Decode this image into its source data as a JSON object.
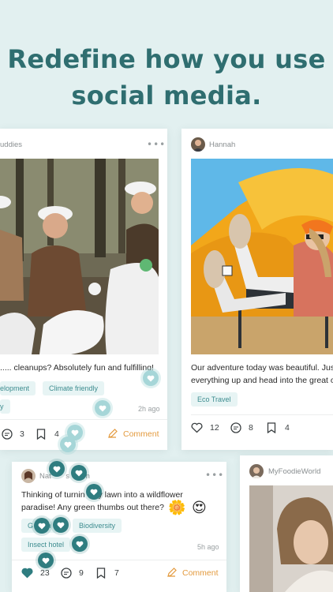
{
  "headline": {
    "line1": "Redefine how you use",
    "line2": "social media."
  },
  "colors": {
    "background": "#e2f0f0",
    "headline": "#2f6e70",
    "accent": "#2f7d80",
    "comment": "#e39a3e",
    "tag_bg": "#e7f4f4",
    "tag_text": "#3d8c8f"
  },
  "post_left": {
    "username": "uddies",
    "caption": "..... cleanups? Absolutely fun and fulfilling!",
    "tags": [
      "elopment",
      "Climate friendly",
      "y"
    ],
    "time": "2h ago",
    "comment_count": "3",
    "save_count": "4",
    "comment_label": "Comment",
    "icons": [
      "more-icon",
      "comment-icon",
      "bookmark-icon",
      "pencil-icon",
      "heart-icon"
    ]
  },
  "post_right": {
    "username": "Hannah",
    "caption_line1": "Our adventure today was beautiful. Jus",
    "caption_line2": "everything up and head into the great o",
    "tags": [
      "Eco Travel"
    ],
    "like_count": "12",
    "comment_count": "8",
    "save_count": "4"
  },
  "post_bottom": {
    "username": "Nat       s G    n",
    "caption_line1": "Thinking of turnin     ly lawn into a wildflower",
    "caption_line2": "paradise! Any green thumbs out there?",
    "emojis": [
      "🌼",
      "😍"
    ],
    "tags": [
      "G       n",
      "Biodiversity",
      "Insect hotel"
    ],
    "time": "5h ago",
    "like_count": "23",
    "comment_count": "9",
    "save_count": "7",
    "comment_label": "Comment"
  },
  "post_food": {
    "username": "MyFoodieWorld"
  }
}
